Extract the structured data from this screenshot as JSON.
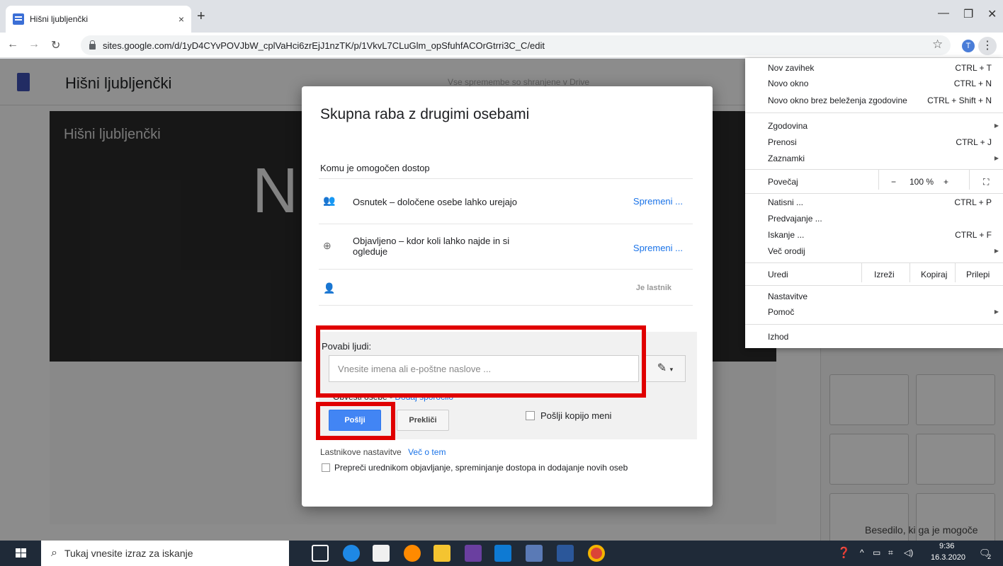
{
  "browser": {
    "tab_title": "Hišni ljubljenčki",
    "tab_close": "×",
    "new_tab": "+",
    "url": "sites.google.com/d/1yD4CYvPOVJbW_cplVaHci6zrEjJ1nzTK/p/1VkvL7CLuGlm_opSfuhfACOrGtrri3C_C/edit",
    "avatar_letter": "T"
  },
  "sites": {
    "title": "Hišni ljubljenčki",
    "saved_note": "Vse spremembe so shranjene v Drive",
    "hero_title": "Hišni ljubljenčki",
    "hero_big": "N",
    "side_text": "Besedilo, ki ga je mogoče"
  },
  "dialog": {
    "title": "Skupna raba z drugimi osebami",
    "access_label": "Komu je omogočen dostop",
    "rows": [
      {
        "text": "Osnutek – določene osebe lahko urejajo",
        "action": "Spremeni ..."
      },
      {
        "text": "Objavljeno – kdor koli lahko najde in si ogleduje",
        "action": "Spremeni ..."
      },
      {
        "text": "",
        "action": "Je lastnik"
      }
    ],
    "invite_label": "Povabi ljudi:",
    "invite_placeholder": "Vnesite imena ali e-poštne naslove ...",
    "notify_text": "Obvesti osebe -",
    "add_message": "Dodaj sporočilo",
    "send": "Pošlji",
    "cancel": "Prekliči",
    "send_copy": "Pošlji kopijo meni",
    "owner_settings": "Lastnikove nastavitve",
    "learn_more": "Več o tem",
    "prevent": "Prepreči urednikom objavljanje, spreminjanje dostopa in dodajanje novih oseb"
  },
  "menu": {
    "new_tab": "Nov zavihek",
    "new_tab_sc": "CTRL + T",
    "new_window": "Novo okno",
    "new_window_sc": "CTRL + N",
    "incognito": "Novo okno brez beleženja zgodovine",
    "incognito_sc": "CTRL + Shift + N",
    "history": "Zgodovina",
    "downloads": "Prenosi",
    "downloads_sc": "CTRL + J",
    "bookmarks": "Zaznamki",
    "zoom": "Povečaj",
    "zoom_minus": "−",
    "zoom_value": "100 %",
    "zoom_plus": "+",
    "print": "Natisni ...",
    "print_sc": "CTRL + P",
    "translate": "Predvajanje ...",
    "find": "Iskanje ...",
    "find_sc": "CTRL + F",
    "more_tools": "Več orodij",
    "edit": "Uredi",
    "cut": "Izreži",
    "copy": "Kopiraj",
    "paste": "Prilepi",
    "settings": "Nastavitve",
    "help": "Pomoč",
    "exit": "Izhod"
  },
  "taskbar": {
    "search_placeholder": "Tukaj vnesite izraz za iskanje",
    "time": "9:36",
    "date": "16.3.2020",
    "notif_count": "2"
  }
}
